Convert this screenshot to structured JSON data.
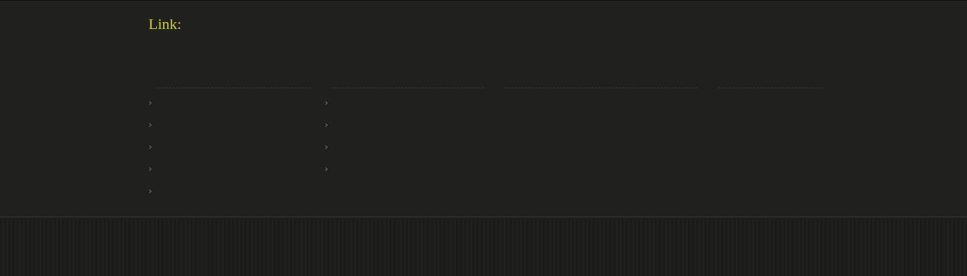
{
  "heading": "Link:",
  "columns": [
    {
      "kind": "list",
      "items": [
        "›",
        "›",
        "›",
        "›",
        "›"
      ]
    },
    {
      "kind": "list",
      "items": [
        "›",
        "›",
        "›",
        "›"
      ]
    },
    {
      "kind": "empty"
    },
    {
      "kind": "empty"
    }
  ]
}
